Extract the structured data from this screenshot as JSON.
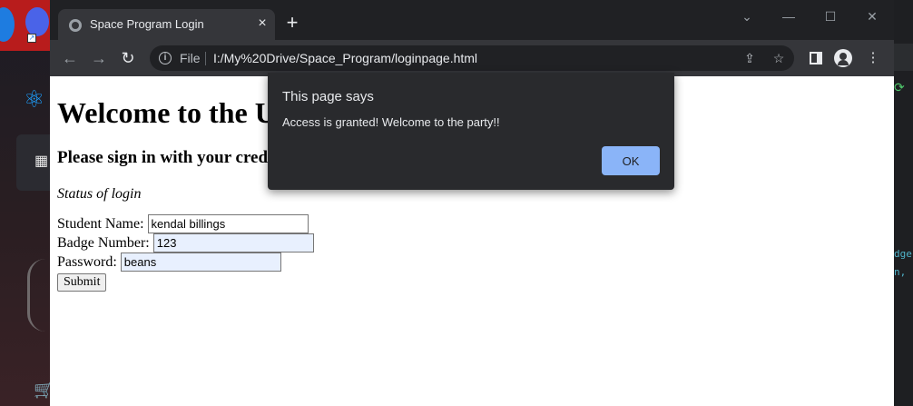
{
  "colors": {
    "desktop_accent": "#b81c1c",
    "titlebar": "#202124",
    "toolbar": "#35363a",
    "dialog_bg": "#292a2d",
    "dialog_button": "#8ab4f8",
    "autofill_bg": "#e8f0fe"
  },
  "desktop": {
    "right_code_1": "dge",
    "right_code_2": "n,"
  },
  "browser": {
    "tab": {
      "title": "Space Program Login",
      "favicon": "globe-icon",
      "close_icon": "close-icon"
    },
    "new_tab_icon": "plus-icon",
    "window_controls": {
      "dropdown": "⌄",
      "minimize": "—",
      "maximize": "☐",
      "close": "✕"
    },
    "toolbar": {
      "back_icon": "arrow-left-icon",
      "forward_icon": "arrow-right-icon",
      "reload_icon": "reload-icon",
      "scheme": "File",
      "url": "I:/My%20Drive/Space_Program/loginpage.html",
      "share_icon": "share-icon",
      "bookmark_icon": "star-icon",
      "sidepanel_icon": "side-panel-icon",
      "profile_icon": "profile-icon",
      "menu_icon": "kebab-menu-icon"
    }
  },
  "page": {
    "heading": "Welcome to the U",
    "subheading": "Please sign in with your crede",
    "status": "Status of login",
    "form": {
      "name_label": "Student Name:",
      "name_value": "kendal billings",
      "badge_label": "Badge Number:",
      "badge_value": "123",
      "password_label": "Password:",
      "password_value": "beans",
      "submit_label": "Submit"
    }
  },
  "dialog": {
    "title": "This page says",
    "message": "Access is granted! Welcome to the party!!",
    "ok_label": "OK"
  }
}
